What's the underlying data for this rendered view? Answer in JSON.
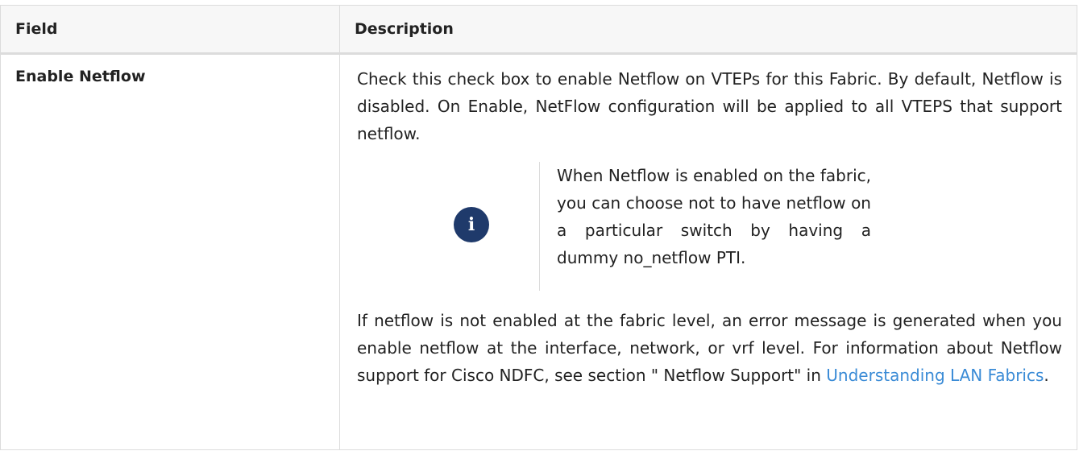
{
  "table": {
    "headers": {
      "field": "Field",
      "description": "Description"
    },
    "rows": [
      {
        "field": "Enable Netflow",
        "description": {
          "para1": "Check this check box to enable Netflow on VTEPs for this Fabric. By default, Netflow is disabled. On Enable, NetFlow configuration will be applied to all VTEPS that support netflow.",
          "note": {
            "icon": "info-icon",
            "text": "When Netflow is enabled on the fabric, you can choose not to have netflow on a particular switch by having a dummy no_netflow PTI."
          },
          "para2_text": "If netflow is not enabled at the fabric level, an error message is generated when you enable netflow at the interface, network, or vrf level. For information about Netflow support for Cisco NDFC, see section \" Netflow Support\"  in ",
          "para2_link": "Understanding LAN Fabrics",
          "para2_end": "."
        }
      }
    ]
  },
  "colors": {
    "link": "#3a8bd6",
    "note_icon_bg": "#1f3a6b",
    "header_bg": "#f7f7f7",
    "border": "#dcdcdc"
  }
}
